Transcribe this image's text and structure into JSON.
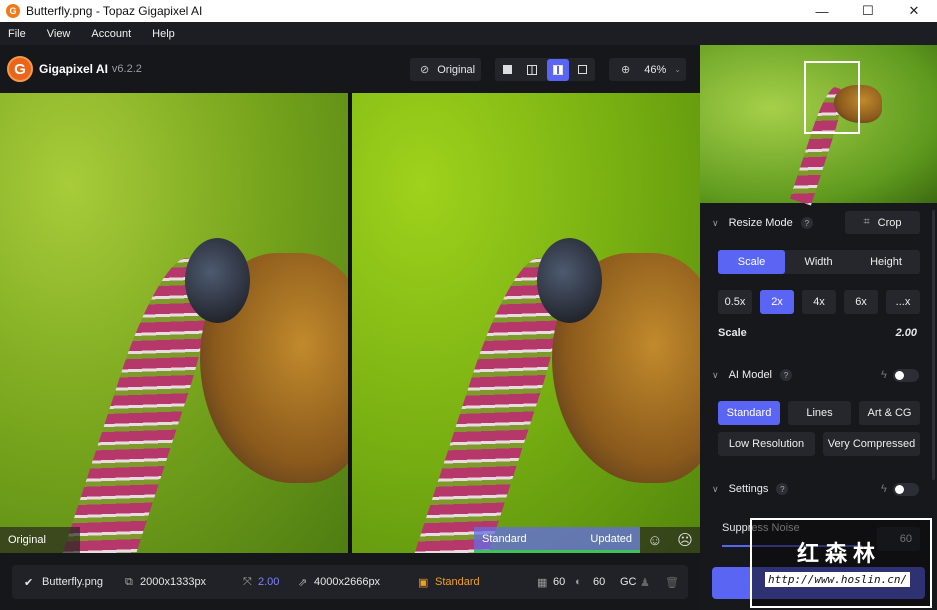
{
  "window": {
    "title": "Butterfly.png - Topaz Gigapixel AI",
    "minimize": "—",
    "maximize": "☐",
    "close": "✕"
  },
  "menu": [
    "File",
    "View",
    "Account",
    "Help"
  ],
  "header": {
    "logo_letter": "G",
    "app_name": "Gigapixel AI",
    "version": "v6.2.2",
    "original_label": "Original",
    "zoom": "46%"
  },
  "preview": {
    "left_label": "Original",
    "model_label": "Standard",
    "status_label": "Updated"
  },
  "info": {
    "filename": "Butterfly.png",
    "input_size": "2000x1333px",
    "scale": "2.00",
    "output_size": "4000x2666px",
    "model": "Standard",
    "noise": "60",
    "blur": "60",
    "gc": "GC"
  },
  "panel": {
    "resize_mode": "Resize Mode",
    "crop": "Crop",
    "modes": [
      "Scale",
      "Width",
      "Height"
    ],
    "scales": [
      "0.5x",
      "2x",
      "4x",
      "6x",
      "...x"
    ],
    "scale_label": "Scale",
    "scale_value": "2.00",
    "ai_model": "AI Model",
    "models": [
      "Standard",
      "Lines",
      "Art & CG",
      "Low Resolution",
      "Very Compressed"
    ],
    "settings": "Settings",
    "suppress_noise": "Suppress Noise",
    "suppress_noise_value": "60",
    "help": "?"
  },
  "watermark": {
    "text": "红森林",
    "url": "http://www.hoslin.cn/"
  },
  "colors": {
    "accent": "#5b65f3",
    "orange": "#f0a020"
  }
}
